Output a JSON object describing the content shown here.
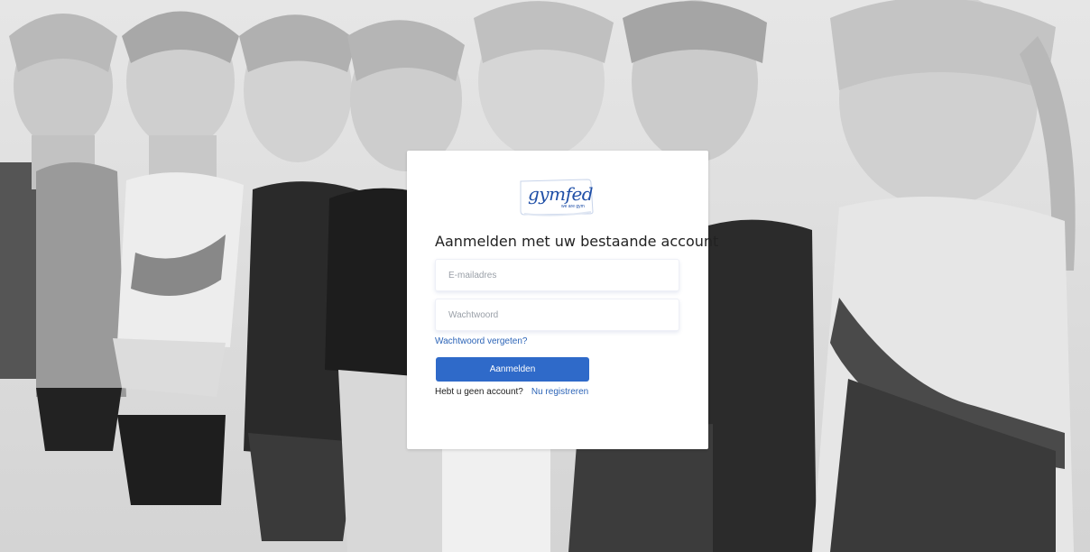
{
  "logo": {
    "text": "gymfed",
    "tagline": "we are gym"
  },
  "login": {
    "heading": "Aanmelden met uw bestaande account",
    "email_placeholder": "E-mailadres",
    "password_placeholder": "Wachtwoord",
    "forgot_link": "Wachtwoord vergeten?",
    "submit_label": "Aanmelden",
    "no_account_text": "Hebt u geen account?",
    "register_link": "Nu registreren"
  },
  "colors": {
    "accent": "#2f6ac9",
    "link": "#2c64b7",
    "brand": "#1f4fa7"
  },
  "icons": {
    "logo": "gymfed-logo"
  }
}
